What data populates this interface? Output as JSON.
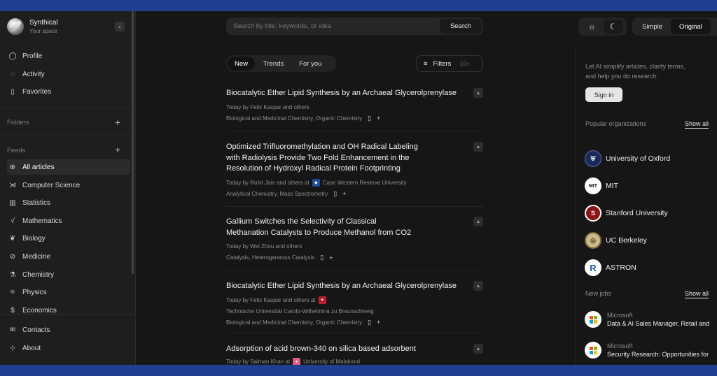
{
  "brand": {
    "title": "Synthical",
    "subtitle": "Your space",
    "collapse_icon": "‹"
  },
  "sidebar": {
    "top_items": [
      {
        "label": "Profile",
        "icon": "user-icon",
        "glyph": "◯"
      },
      {
        "label": "Activity",
        "icon": "chat-icon",
        "glyph": "◌"
      },
      {
        "label": "Favorites",
        "icon": "bookmark-icon",
        "glyph": "▯"
      }
    ],
    "folders_label": "Folders",
    "feeds_label": "Feeds",
    "plus": "+",
    "feeds": [
      {
        "label": "All articles",
        "icon": "globe-icon",
        "glyph": "⊕"
      },
      {
        "label": "Computer Science",
        "icon": "network-icon",
        "glyph": "⋊"
      },
      {
        "label": "Statistics",
        "icon": "chart-icon",
        "glyph": "▥"
      },
      {
        "label": "Mathematics",
        "icon": "sqrt-icon",
        "glyph": "√"
      },
      {
        "label": "Biology",
        "icon": "leaf-icon",
        "glyph": "❦"
      },
      {
        "label": "Medicine",
        "icon": "pill-icon",
        "glyph": "⊘"
      },
      {
        "label": "Chemistry",
        "icon": "flask-icon",
        "glyph": "⚗"
      },
      {
        "label": "Physics",
        "icon": "atom-icon",
        "glyph": "⚛"
      },
      {
        "label": "Economics",
        "icon": "dollar-icon",
        "glyph": "$"
      }
    ],
    "bottom_items": [
      {
        "label": "Contacts",
        "icon": "mail-icon",
        "glyph": "✉"
      },
      {
        "label": "About",
        "icon": "info-icon",
        "glyph": "⊹"
      }
    ]
  },
  "search": {
    "placeholder": "Search by title, keywords, or idea",
    "button": "Search"
  },
  "tabs": [
    "New",
    "Trends",
    "For you"
  ],
  "filters": {
    "label": "Filters",
    "count": "10+",
    "icon": "≡"
  },
  "articles": [
    {
      "title": "Biocatalytic Ether Lipid Synthesis by an Archaeal Glycerolprenylase",
      "meta": "Today by Felix Kaspar and others",
      "institution": "",
      "tags": "Biological and Medicinal Chemistry, Organic Chemistry"
    },
    {
      "title": "Optimized Trifluoromethylation and OH Radical Labeling with Radiolysis Provide Two Fold Enhancement in the Resolution of Hydroxyl Radical Protein Footprinting",
      "meta": "Today by Rohit Jain and others at",
      "institution": "Case Western Reserve University",
      "tags": "Analytical Chemistry, Mass Spectrometry"
    },
    {
      "title": "Gallium Switches the Selectivity of Classical Methanation Catalysts to Produce Methanol from CO2",
      "meta": "Today by Wei Zhou and others",
      "institution": "",
      "tags": "Catalysis, Heterogeneous Catalysis"
    },
    {
      "title": "Biocatalytic Ether Lipid Synthesis by an Archaeal Glycerolprenylase",
      "meta": "Today by Felix Kaspar and others at",
      "institution": "Technische Universität Carolo-Wilhelmina zu Braunschweig",
      "tags": "Biological and Medicinal Chemistry, Organic Chemistry"
    },
    {
      "title": "Adsorption of acid brown-340 on silica based adsorbent",
      "meta": "Today by Salman Khan at",
      "institution": "University of Malakand",
      "tags": ""
    }
  ],
  "icons": {
    "bookmark": "▯",
    "plus": "+",
    "upvote": "▲",
    "sun": "☼",
    "moon": "☾"
  },
  "mode": {
    "simple": "Simple",
    "original": "Original"
  },
  "right": {
    "intro": "Let AI simplify articles, clarify terms, and help you do research.",
    "signin": "Sign in",
    "orgs_label": "Popular organizations",
    "show_all": "Show all",
    "orgs": [
      {
        "name": "University of Oxford",
        "logo_color": "#1a2a5a",
        "mark": "⛨"
      },
      {
        "name": "MIT",
        "logo_color": "#ffffff",
        "mark": "MIT"
      },
      {
        "name": "Stanford University",
        "logo_color": "#8c1515",
        "mark": "S"
      },
      {
        "name": "UC Berkeley",
        "logo_color": "#c9b98a",
        "mark": "◎"
      },
      {
        "name": "ASTRON",
        "logo_color": "#ffffff",
        "mark": "R"
      }
    ],
    "jobs_label": "New jobs",
    "jobs": [
      {
        "company": "Microsoft",
        "title": "Data & AI Sales Manager, Retail and"
      },
      {
        "company": "Microsoft",
        "title": "Security Research: Opportunities for"
      }
    ],
    "colors": {
      "ms_red": "#f25022",
      "ms_green": "#7fba00",
      "ms_blue": "#00a4ef",
      "ms_yellow": "#ffb900"
    }
  }
}
